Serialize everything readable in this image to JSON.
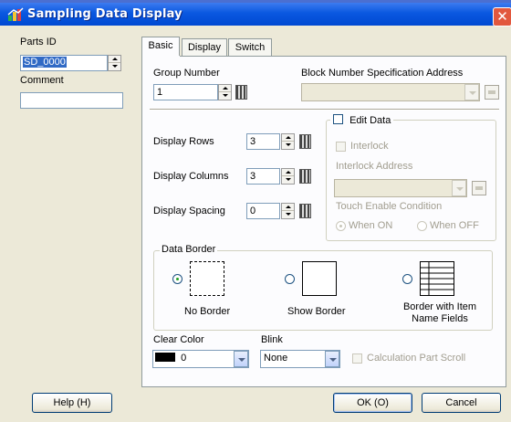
{
  "window": {
    "title": "Sampling Data Display"
  },
  "left": {
    "parts_id_label": "Parts ID",
    "parts_id_value": "SD_0000",
    "comment_label": "Comment",
    "comment_value": ""
  },
  "tabs": [
    {
      "label": "Basic",
      "active": true
    },
    {
      "label": "Display",
      "active": false
    },
    {
      "label": "Switch",
      "active": false
    }
  ],
  "basic": {
    "group_number_label": "Group Number",
    "group_number_value": "1",
    "block_addr_label": "Block Number Specification Address",
    "block_addr_value": "",
    "display_rows_label": "Display Rows",
    "display_rows_value": "3",
    "display_columns_label": "Display Columns",
    "display_columns_value": "3",
    "display_spacing_label": "Display Spacing",
    "display_spacing_value": "0",
    "edit_data_label": "Edit Data",
    "interlock_label": "Interlock",
    "interlock_address_label": "Interlock Address",
    "interlock_address_value": "",
    "touch_enable_label": "Touch Enable Condition",
    "when_on_label": "When ON",
    "when_off_label": "When OFF",
    "data_border_label": "Data Border",
    "border_options": [
      "No Border",
      "Show Border",
      "Border with Item Name Fields"
    ],
    "selected_border": "No Border",
    "clear_color_label": "Clear Color",
    "clear_color_value": "0",
    "clear_color_swatch": "#000000",
    "blink_label": "Blink",
    "blink_value": "None",
    "calc_scroll_label": "Calculation Part Scroll"
  },
  "footer": {
    "help_label": "Help (H)",
    "ok_label": "OK (O)",
    "cancel_label": "Cancel"
  },
  "colors": {
    "title_bar": "#0a58e0",
    "dialog_bg": "#ece9d8",
    "selection": "#316ac5"
  }
}
